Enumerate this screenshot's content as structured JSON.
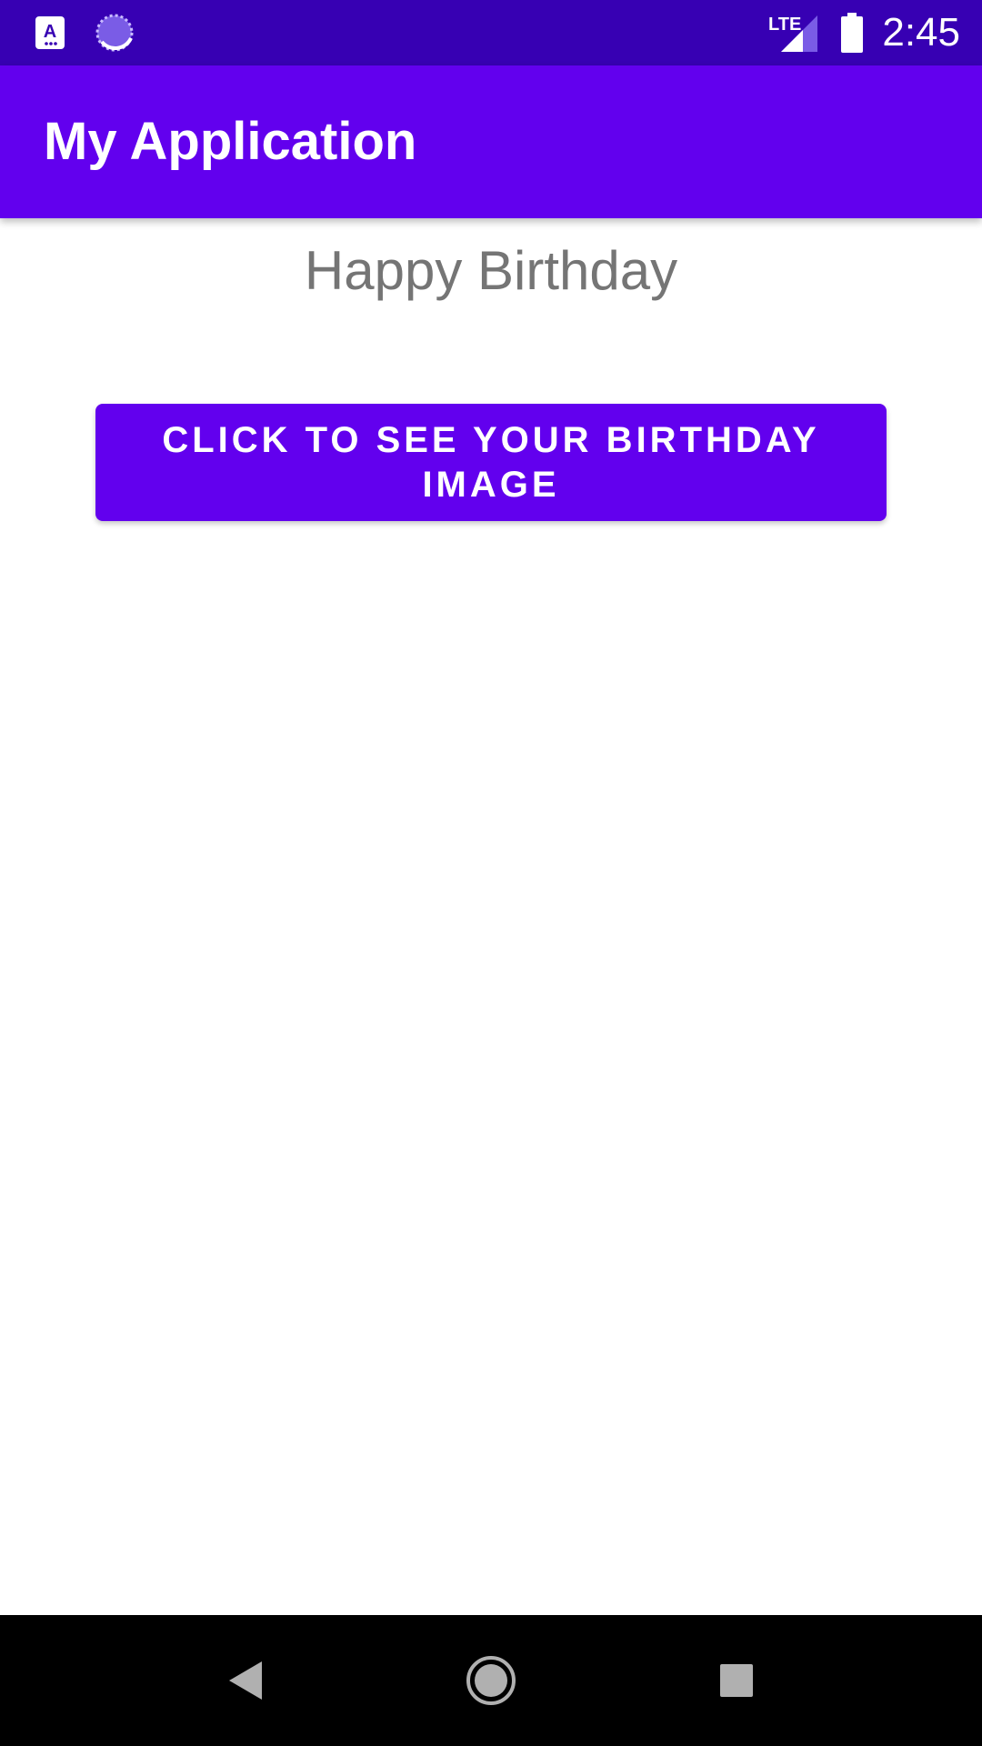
{
  "status_bar": {
    "time": "2:45",
    "network": "LTE",
    "icons": [
      "accessibility-app-icon",
      "sync-spinner-icon",
      "lte-signal-icon",
      "battery-icon"
    ]
  },
  "app_bar": {
    "title": "My Application"
  },
  "main": {
    "greeting": "Happy Birthday",
    "button_label": "Click to see your birthday image"
  },
  "nav_bar": {
    "icons": [
      "back-icon",
      "home-icon",
      "recents-icon"
    ]
  },
  "colors": {
    "status_bar": "#3700B3",
    "primary": "#6200EE",
    "greeting_text": "#757575",
    "nav_bar": "#000000",
    "nav_icons": "#B0B0B0"
  }
}
